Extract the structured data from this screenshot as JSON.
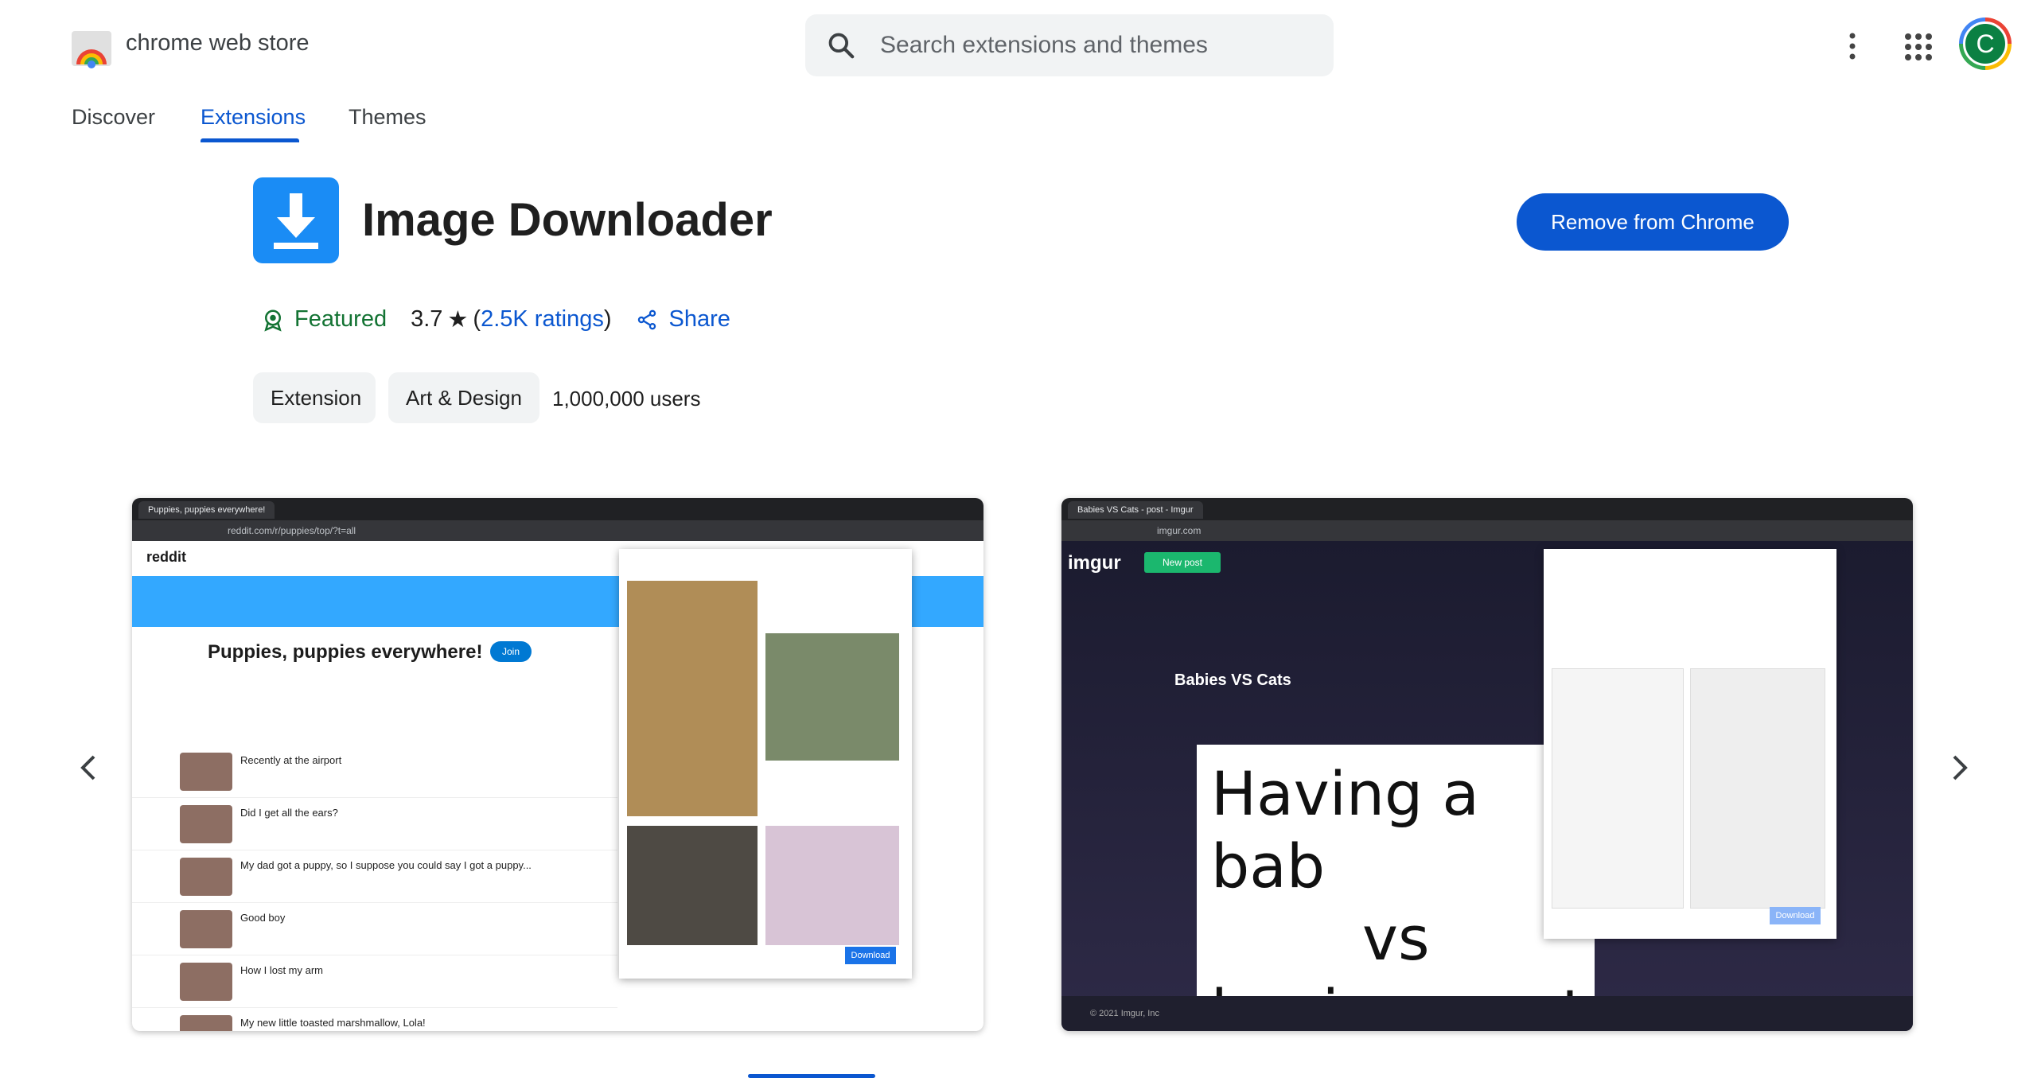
{
  "header": {
    "store_name": "chrome web store",
    "search_placeholder": "Search extensions and themes",
    "avatar_letter": "C"
  },
  "nav": {
    "tabs": [
      {
        "label": "Discover",
        "active": false
      },
      {
        "label": "Extensions",
        "active": true
      },
      {
        "label": "Themes",
        "active": false
      }
    ]
  },
  "extension": {
    "name": "Image Downloader",
    "action_label": "Remove from Chrome",
    "featured_label": "Featured",
    "rating": "3.7",
    "ratings_label": "2.5K ratings",
    "share_label": "Share",
    "chips": [
      "Extension",
      "Art & Design"
    ],
    "users": "1,000,000 users"
  },
  "screenshots": [
    {
      "tab_title": "Puppies, puppies everywhere!",
      "url": "reddit.com/r/puppies/top/?t=all",
      "site": "reddit",
      "subreddit_title": "Puppies, puppies everywhere!",
      "join_label": "Join",
      "posts": [
        "Recently at the airport",
        "Did I get all the ears?",
        "My dad got a puppy, so I suppose you could say I got a puppy...",
        "Good boy",
        "How I lost my arm",
        "My new little toasted marshmallow, Lola!"
      ],
      "download_label": "Download"
    },
    {
      "tab_title": "Babies VS Cats - post - Imgur",
      "url": "imgur.com",
      "site": "imgur",
      "new_post_label": "New post",
      "post_title": "Babies VS Cats",
      "comic_lines": [
        "Having a bab",
        "vs",
        "having a cat"
      ],
      "footer": "© 2021 Imgur, Inc"
    }
  ],
  "colors": {
    "accent": "#0b57d0",
    "featured": "#137333",
    "icon_blue": "#1a8cf5"
  }
}
